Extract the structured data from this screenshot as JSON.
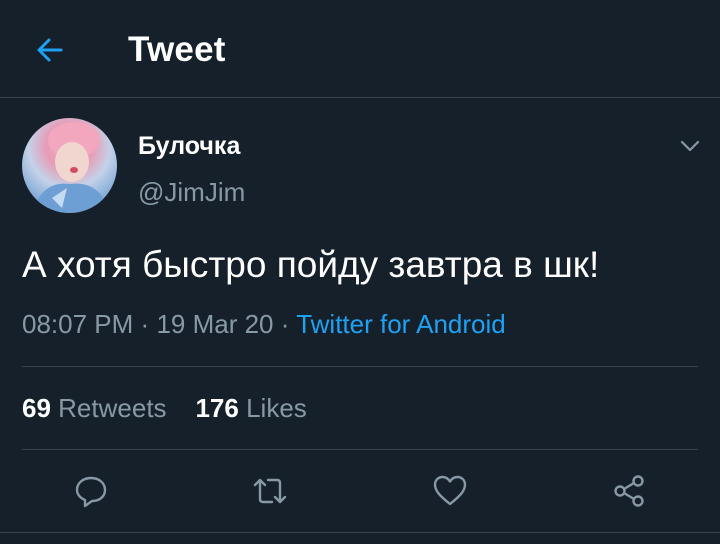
{
  "header": {
    "title": "Tweet"
  },
  "tweet": {
    "author_name": "Булочка",
    "author_handle": "@JimJim",
    "text": "А хотя быстро пойду завтра в шк!",
    "time": "08:07 PM",
    "date": "19 Mar 20",
    "source": "Twitter for Android",
    "separator": "·"
  },
  "stats": {
    "retweets_count": "69",
    "retweets_label": "Retweets",
    "likes_count": "176",
    "likes_label": "Likes"
  },
  "icons": {
    "back": "arrow-left-icon",
    "more": "chevron-down-icon",
    "reply": "reply-icon",
    "retweet": "retweet-icon",
    "like": "heart-icon",
    "share": "share-icon"
  },
  "colors": {
    "background": "#15202b",
    "accent": "#1da1f2",
    "secondary_text": "#8899a6",
    "divider": "#38444d"
  }
}
